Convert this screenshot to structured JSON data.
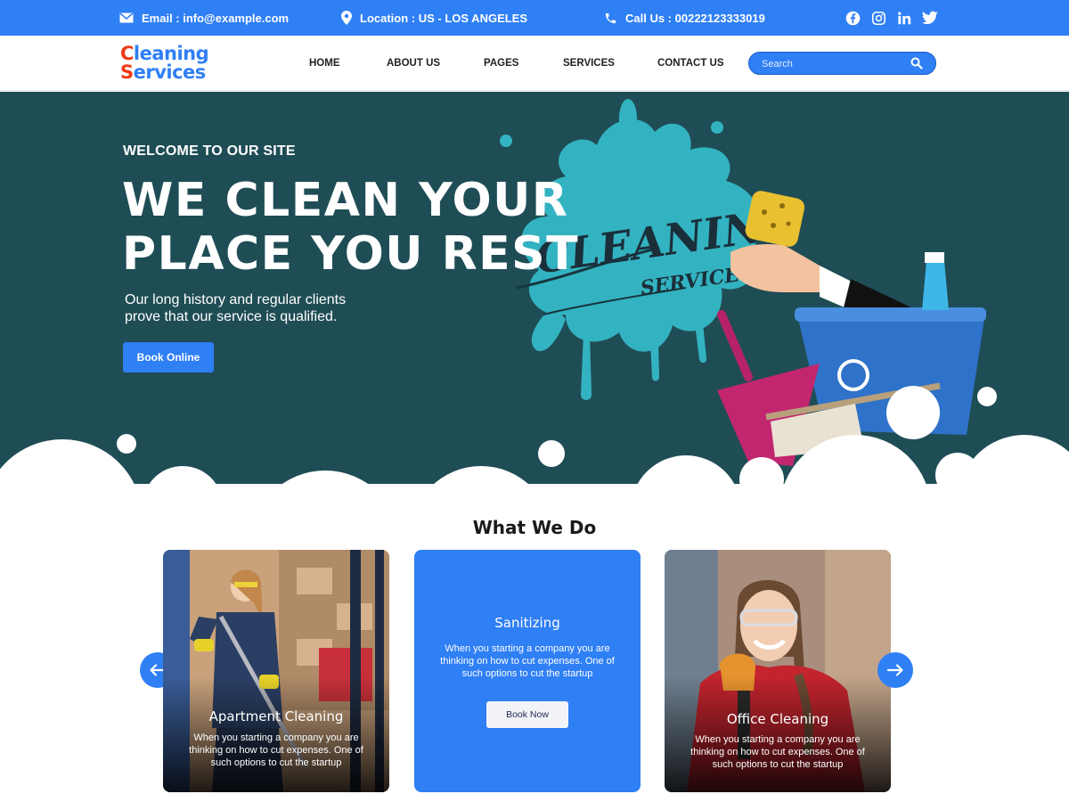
{
  "topbar": {
    "email": "Email : info@example.com",
    "location": "Location : US - LOS ANGELES",
    "phone": "Call Us : 00222123333019",
    "social": [
      "facebook-icon",
      "instagram-icon",
      "linkedin-icon",
      "twitter-icon"
    ]
  },
  "logo": {
    "line1_first": "C",
    "line1_rest": "leaning",
    "line2_first": "S",
    "line2_rest": "ervices"
  },
  "nav": [
    "HOME",
    "ABOUT US",
    "PAGES",
    "SERVICES",
    "CONTACT US"
  ],
  "search": {
    "placeholder": "Search"
  },
  "hero": {
    "welcome": "WELCOME TO OUR SITE",
    "headline_line1": "WE CLEAN YOUR",
    "headline_line2": "PLACE YOU REST",
    "sub_line1": "Our long history and regular clients",
    "sub_line2": "prove that our service is qualified.",
    "cta": "Book Online",
    "illustration_line1": "CLEANING",
    "illustration_line2": "SERVICE"
  },
  "services": {
    "title": "What We Do",
    "cards": [
      {
        "title": "Apartment Cleaning",
        "text": "When you starting a company you are thinking on how to cut expenses. One of such options to cut the startup"
      },
      {
        "title": "Sanitizing",
        "text": "When you starting a company you are thinking on how to cut expenses. One of such options to cut the startup",
        "button": "Book Now"
      },
      {
        "title": "Office Cleaning",
        "text": "When you starting a company you are thinking on how to cut expenses. One of such options to cut the startup"
      }
    ]
  },
  "colors": {
    "accent": "#2f7ff5",
    "hero_bg": "#1f4d55",
    "logo_red": "#ec3a16"
  }
}
